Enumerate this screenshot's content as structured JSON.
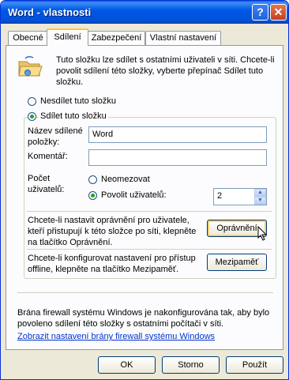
{
  "window": {
    "title": "Word - vlastnosti",
    "help_label": "?",
    "close_label": "✕"
  },
  "tabs": [
    {
      "label": "Obecné",
      "active": false
    },
    {
      "label": "Sdílení",
      "active": true
    },
    {
      "label": "Zabezpečení",
      "active": false
    },
    {
      "label": "Vlastní nastavení",
      "active": false
    }
  ],
  "sharing": {
    "intro": "Tuto složku lze sdílet s ostatními uživateli v síti. Chcete-li povolit sdílení této složky, vyberte přepínač Sdílet tuto složku.",
    "no_share_label": "Nesdílet tuto složku",
    "share_label": "Sdílet tuto složku",
    "share_name_label": "Název sdílené položky:",
    "share_name_value": "Word",
    "comment_label": "Komentář:",
    "comment_value": "",
    "user_limit_label": "Počet uživatelů:",
    "unlimited_label": "Neomezovat",
    "allow_label": "Povolit uživatelů:",
    "allow_value": "2",
    "permissions_text": "Chcete-li nastavit oprávnění pro uživatele, kteří přistupují k této složce po síti, klepněte na tlačítko Oprávnění.",
    "permissions_button": "Oprávnění",
    "caching_text": "Chcete-li konfigurovat nastavení pro přístup offline, klepněte na tlačítko Mezipaměť.",
    "caching_button": "Mezipaměť"
  },
  "firewall": {
    "text": "Brána firewall systému Windows je nakonfigurována tak, aby bylo povoleno sdílení této složky s ostatními počítači v síti.",
    "link": "Zobrazit nastavení brány firewall systému Windows"
  },
  "footer": {
    "ok": "OK",
    "cancel": "Storno",
    "apply": "Použít"
  }
}
